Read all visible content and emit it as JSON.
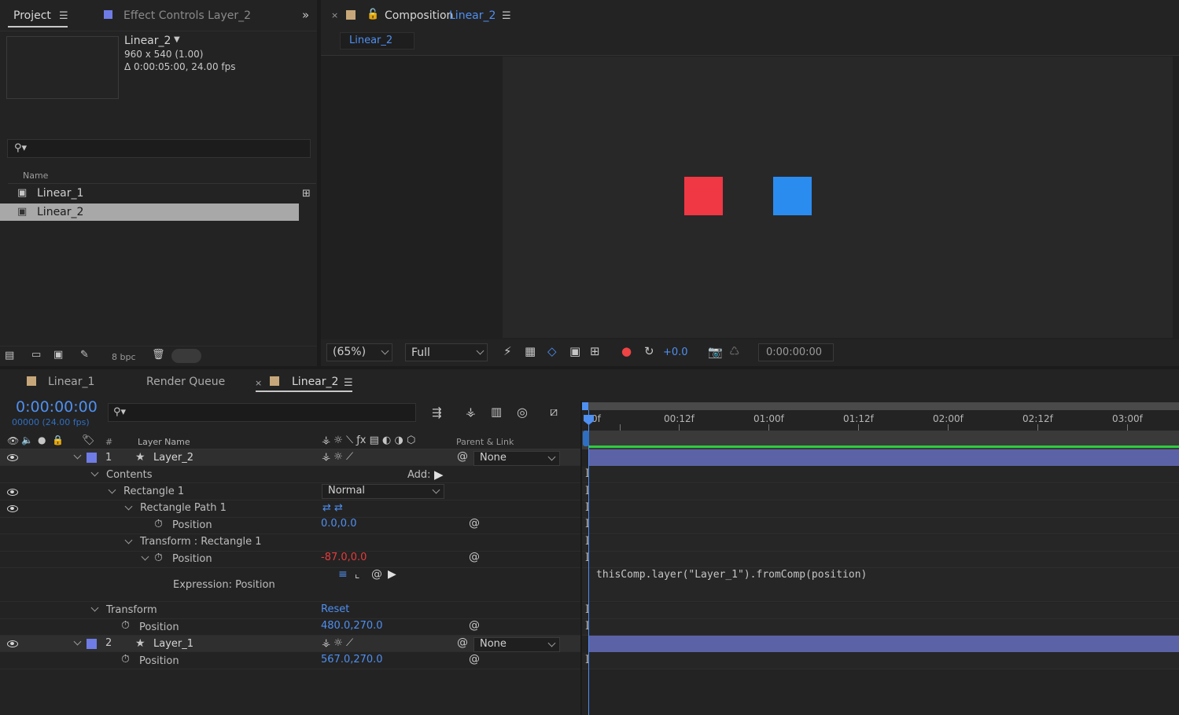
{
  "project_panel": {
    "tab_project": "Project",
    "tab_effect_controls": "Effect Controls Layer_2",
    "selected_name": "Linear_2",
    "selected_dims": "960 x 540 (1.00)",
    "selected_duration": "Δ 0:00:05:00, 24.00 fps",
    "column_name": "Name",
    "items": [
      {
        "label": "Linear_1",
        "selected": false
      },
      {
        "label": "Linear_2",
        "selected": true
      }
    ],
    "bpc": "8 bpc"
  },
  "comp_viewer": {
    "tab_prefix": "Composition",
    "tab_comp_name": "Linear_2",
    "sub_tab": "Linear_2",
    "zoom": "(65%)",
    "resolution": "Full",
    "exposure": "+0.0",
    "timecode": "0:00:00:00",
    "shape_colors": {
      "red": "#f03744",
      "blue": "#2b8cf0"
    }
  },
  "timeline": {
    "tabs": [
      "Linear_1",
      "Render Queue",
      "Linear_2"
    ],
    "current_time": "0:00:00:00",
    "fps_label": "00000 (24.00 fps)",
    "col_hash": "#",
    "col_layer_name": "Layer Name",
    "col_parent": "Parent & Link",
    "ruler_labels": [
      "0f",
      "00:12f",
      "01:00f",
      "01:12f",
      "02:00f",
      "02:12f",
      "03:00f"
    ],
    "add_label": "Add:",
    "layer1": {
      "num": "1",
      "name": "Layer_2",
      "parent": "None"
    },
    "contents": "Contents",
    "rectangle1": "Rectangle 1",
    "blend_mode": "Normal",
    "rect_path": "Rectangle Path 1",
    "position_label": "Position",
    "rect_path_position": "0.0,0.0",
    "transform_rect": "Transform : Rectangle 1",
    "transform_rect_position": "-87.0,0.0",
    "expression_label": "Expression: Position",
    "expression_code": "thisComp.layer(\"Layer_1\").fromComp(position)",
    "transform": "Transform",
    "reset": "Reset",
    "transform_position": "480.0,270.0",
    "layer2": {
      "num": "2",
      "name": "Layer_1",
      "parent": "None"
    },
    "layer2_position": "567.0,270.0",
    "colors": {
      "layer_label": "#6f7ce6",
      "bar": "#5c62a6",
      "accent": "#4f8ff0"
    }
  }
}
